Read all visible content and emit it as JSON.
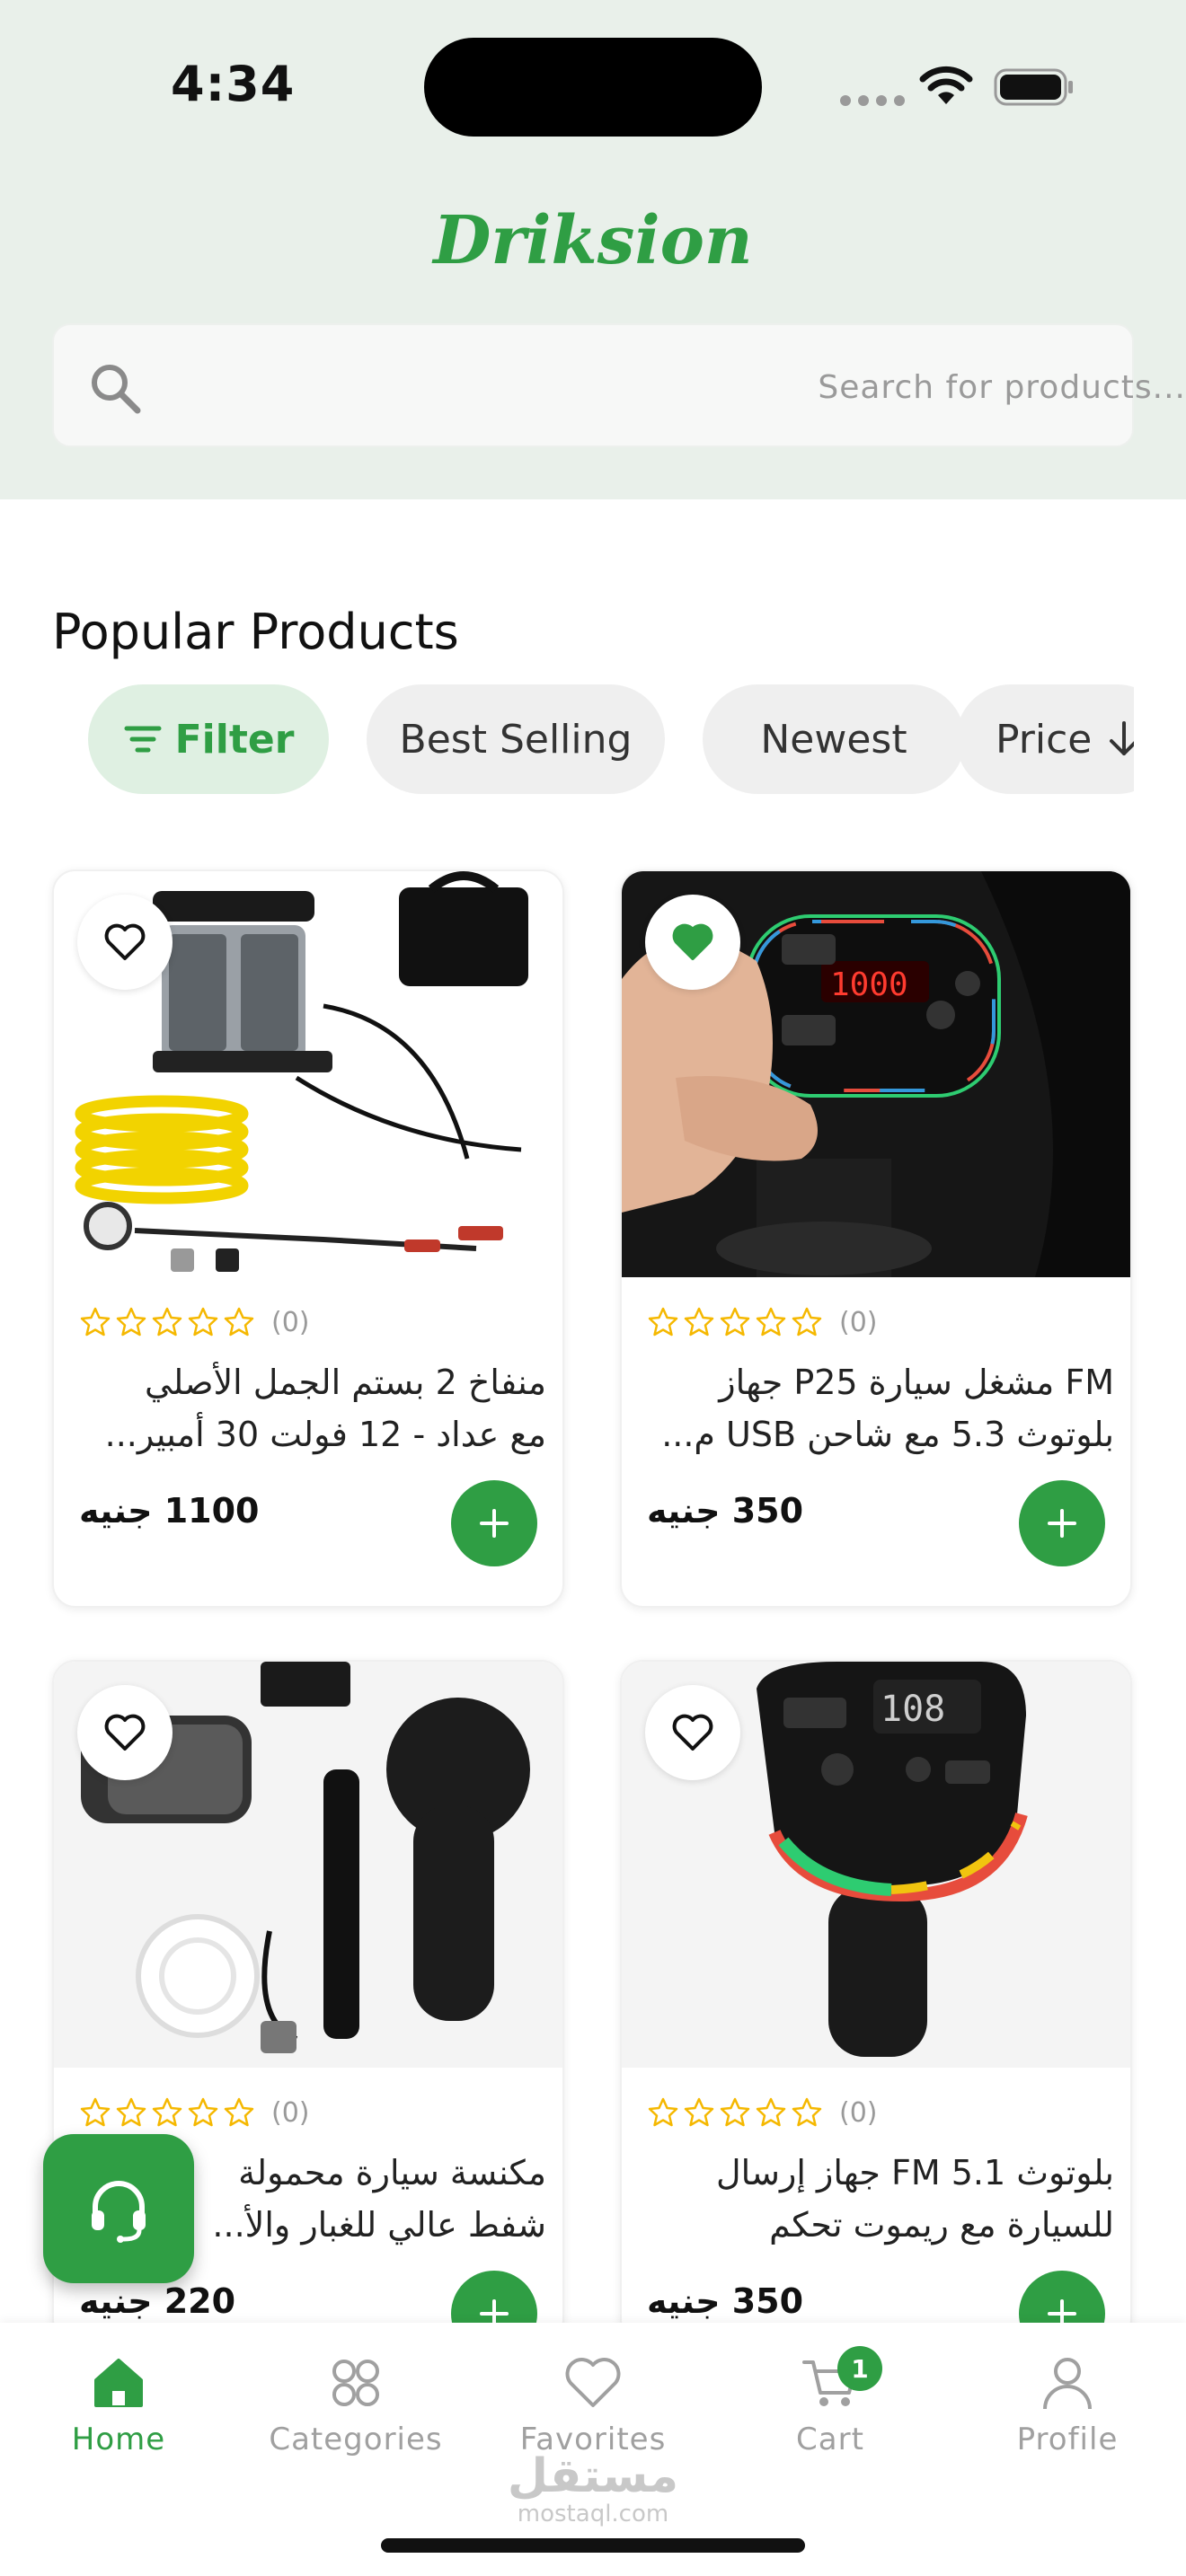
{
  "status_bar": {
    "time": "4:34"
  },
  "header": {
    "brand": "Driksion"
  },
  "search": {
    "placeholder": "Search for products..."
  },
  "section": {
    "title": "Popular Products"
  },
  "filters": {
    "filter_label": "Filter",
    "chips": [
      "Best Selling",
      "Newest",
      "Price"
    ]
  },
  "colors": {
    "accent": "#2f9e44",
    "header_bg": "#e9f0ea",
    "star": "#f5b800"
  },
  "products": [
    {
      "name_line1": "منفاخ 2 بستم الجمل الأصلي",
      "name_line2": "مع عداد - 12 فولت 30 أمبير...",
      "rating_count": "(0)",
      "price": "1100 جنيه",
      "favorited": false,
      "image": "air-compressor-kit"
    },
    {
      "name_line1": "FM مشغل سيارة P25 جهاز",
      "name_line2": "بلوتوث 5.3 مع شاحن USB م...",
      "rating_count": "(0)",
      "price": "350 جنيه",
      "favorited": true,
      "image": "fm-transmitter-hand"
    },
    {
      "name_line1": "مكنسة سيارة محمولة",
      "name_line2": "شفط عالي للغبار والأ...",
      "rating_count": "(0)",
      "price": "220 جنيه",
      "favorited": false,
      "image": "car-vacuum-kit"
    },
    {
      "name_line1": "بلوتوث FM 5.1 جهاز إرسال",
      "name_line2": "للسيارة مع ريموت تحكم",
      "rating_count": "(0)",
      "price": "350 جنيه",
      "favorited": false,
      "image": "fm-transmitter-rgb"
    }
  ],
  "bottom_nav": {
    "items": [
      {
        "label": "Home",
        "icon": "home-icon",
        "active": true
      },
      {
        "label": "Categories",
        "icon": "categories-icon",
        "active": false
      },
      {
        "label": "Favorites",
        "icon": "heart-icon",
        "active": false
      },
      {
        "label": "Cart",
        "icon": "cart-icon",
        "active": false,
        "badge": "1"
      },
      {
        "label": "Profile",
        "icon": "profile-icon",
        "active": false
      }
    ]
  },
  "watermark": {
    "arabic": "مستقل",
    "latin": "mostaql.com"
  }
}
